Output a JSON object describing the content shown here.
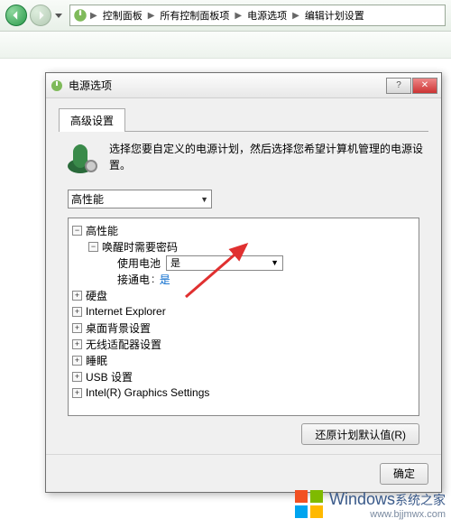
{
  "breadcrumb": {
    "items": [
      "控制面板",
      "所有控制面板项",
      "电源选项",
      "编辑计划设置"
    ]
  },
  "dialog": {
    "title": "电源选项",
    "tab_label": "高级设置",
    "description": "选择您要自定义的电源计划，然后选择您希望计算机管理的电源设置。",
    "plan_select_value": "高性能",
    "restore_defaults": "还原计划默认值(R)",
    "ok": "确定"
  },
  "tree": {
    "root": "高性能",
    "wake_pw": "唤醒时需要密码",
    "on_battery_label": "使用电池",
    "on_battery_value": "是",
    "plugged_label": "接通电",
    "plugged_value": "是",
    "hdd": "硬盘",
    "ie": "Internet Explorer",
    "wallpaper": "桌面背景设置",
    "wifi": "无线适配器设置",
    "sleep": "睡眠",
    "usb": "USB 设置",
    "intel": "Intel(R) Graphics Settings"
  },
  "watermark": {
    "brand": "Windows",
    "site": "系统之家",
    "url": "www.bjjmwx.com"
  }
}
